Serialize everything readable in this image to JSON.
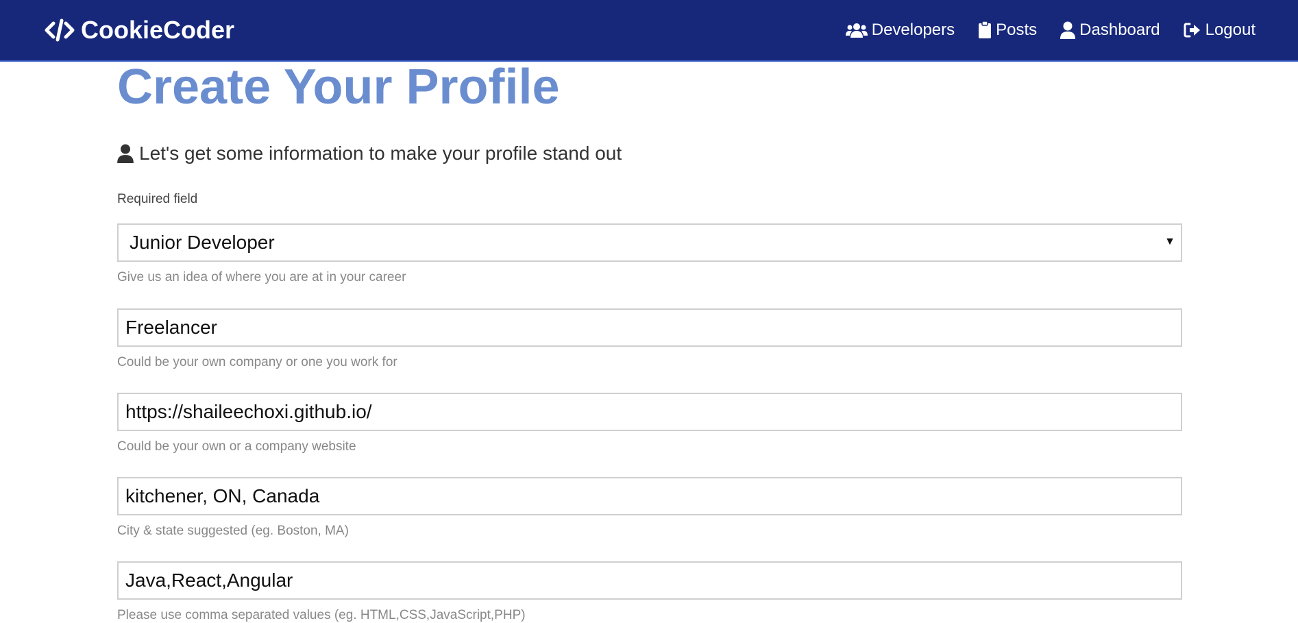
{
  "navbar": {
    "brand": "CookieCoder",
    "brand_icon": "code-icon",
    "background": "#17287b",
    "links": [
      {
        "label": "Developers",
        "icon": "users-icon"
      },
      {
        "label": "Posts",
        "icon": "clipboard-icon"
      },
      {
        "label": "Dashboard",
        "icon": "user-icon"
      },
      {
        "label": "Logout",
        "icon": "logout-icon"
      }
    ]
  },
  "page": {
    "title": "Create Your Profile",
    "title_color": "#6a8dd0",
    "lead": "Let's get some information to make your profile stand out",
    "lead_icon": "user-icon",
    "required": "Required field"
  },
  "form": {
    "status": {
      "value": "Junior Developer",
      "hint": "Give us an idea of where you are at in your career"
    },
    "company": {
      "value": "Freelancer",
      "hint": "Could be your own company or one you work for"
    },
    "website": {
      "value": "https://shaileechoxi.github.io/",
      "hint": "Could be your own or a company website"
    },
    "location": {
      "value": "kitchener, ON, Canada",
      "hint": "City & state suggested (eg. Boston, MA)"
    },
    "skills": {
      "value": "Java,React,Angular",
      "hint": "Please use comma separated values (eg. HTML,CSS,JavaScript,PHP)"
    }
  }
}
